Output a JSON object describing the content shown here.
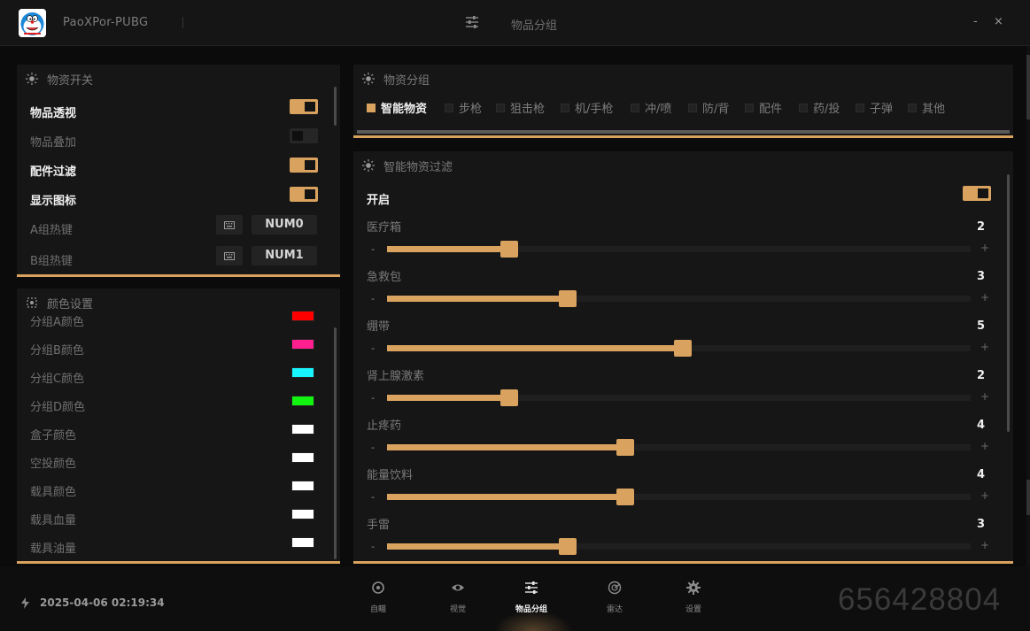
{
  "app": {
    "title": "PaoXPor-PUBG",
    "page_title": "物品分组",
    "minimize_label": "-",
    "close_label": "×"
  },
  "switches_panel": {
    "title": "物资开关",
    "items": [
      {
        "label": "物品透视",
        "on": true
      },
      {
        "label": "物品叠加",
        "on": false
      },
      {
        "label": "配件过滤",
        "on": true
      },
      {
        "label": "显示图标",
        "on": true
      }
    ],
    "hotkeys": [
      {
        "label": "A组热键",
        "key": "NUM0"
      },
      {
        "label": "B组热键",
        "key": "NUM1"
      }
    ]
  },
  "color_panel": {
    "title": "颜色设置",
    "items": [
      {
        "label": "分组A颜色",
        "color": "#ff0000"
      },
      {
        "label": "分组B颜色",
        "color": "#ff1f8f"
      },
      {
        "label": "分组C颜色",
        "color": "#19f5ff"
      },
      {
        "label": "分组D颜色",
        "color": "#11f511"
      },
      {
        "label": "盒子颜色",
        "color": "#ffffff"
      },
      {
        "label": "空投颜色",
        "color": "#ffffff"
      },
      {
        "label": "载具颜色",
        "color": "#ffffff"
      },
      {
        "label": "载具血量",
        "color": "#ffffff"
      },
      {
        "label": "载具油量",
        "color": "#ffffff"
      }
    ]
  },
  "group_panel": {
    "title": "物资分组",
    "tabs": [
      {
        "label": "智能物资",
        "active": true
      },
      {
        "label": "步枪",
        "active": false
      },
      {
        "label": "狙击枪",
        "active": false
      },
      {
        "label": "机/手枪",
        "active": false
      },
      {
        "label": "冲/喷",
        "active": false
      },
      {
        "label": "防/背",
        "active": false
      },
      {
        "label": "配件",
        "active": false
      },
      {
        "label": "药/投",
        "active": false
      },
      {
        "label": "子弹",
        "active": false
      },
      {
        "label": "其他",
        "active": false
      }
    ]
  },
  "filter_panel": {
    "title": "智能物资过滤",
    "enable_label": "开启",
    "enabled": true,
    "minus_label": "-",
    "plus_label": "+",
    "slider_max": 10,
    "sliders": [
      {
        "label": "医疗箱",
        "value": 2
      },
      {
        "label": "急救包",
        "value": 3
      },
      {
        "label": "绷带",
        "value": 5
      },
      {
        "label": "肾上腺激素",
        "value": 2
      },
      {
        "label": "止疼药",
        "value": 4
      },
      {
        "label": "能量饮料",
        "value": 4
      },
      {
        "label": "手雷",
        "value": 3
      }
    ]
  },
  "status": {
    "datetime": "2025-04-06 02:19:34"
  },
  "nav": [
    {
      "label": "自瞄",
      "icon": "crosshair-icon",
      "active": false
    },
    {
      "label": "视觉",
      "icon": "eye-icon",
      "active": false
    },
    {
      "label": "物品分组",
      "icon": "sliders-icon",
      "active": true
    },
    {
      "label": "雷达",
      "icon": "radar-icon",
      "active": false
    },
    {
      "label": "设置",
      "icon": "gear-icon",
      "active": false
    }
  ],
  "watermark": "656428804",
  "colors": {
    "accent": "#d9a25e",
    "panel": "#161616",
    "background": "#0b0b0b"
  }
}
